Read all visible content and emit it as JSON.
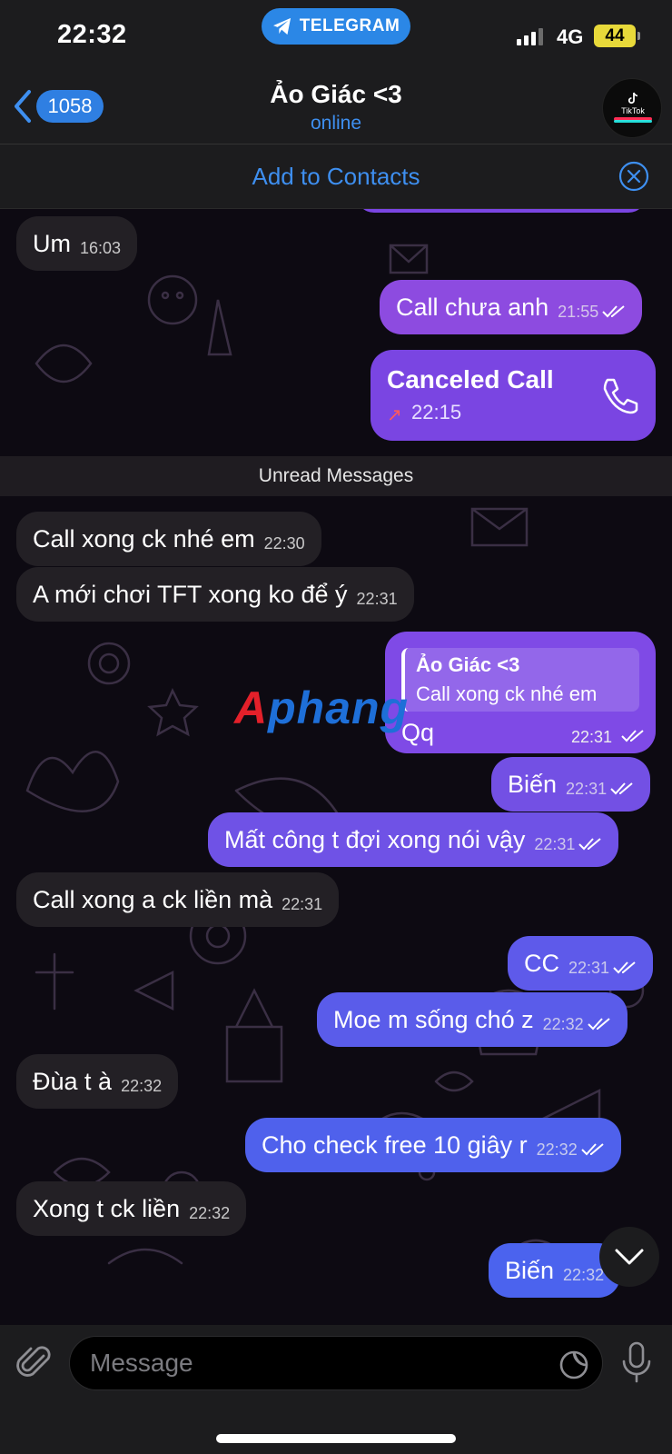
{
  "status_bar": {
    "time": "22:32",
    "app_label": "TELEGRAM",
    "network": "4G",
    "battery": "44"
  },
  "header": {
    "back_count": "1058",
    "title": "Ảo Giác <3",
    "status": "online",
    "avatar_label": "TikTok"
  },
  "banner": {
    "add_contacts": "Add to Contacts"
  },
  "colors": {
    "accent": "#3e8ff0",
    "incoming_bubble": "#232025",
    "outgoing_top": "#8a48e0",
    "outgoing_bottom": "#4a63ec"
  },
  "messages_before": [
    {
      "dir": "in",
      "text": "Um",
      "time": "16:03"
    },
    {
      "dir": "out",
      "text": "Call chưa anh",
      "time": "21:55"
    }
  ],
  "call": {
    "title": "Canceled Call",
    "time": "22:15",
    "icon": "phone-icon"
  },
  "unread_label": "Unread Messages",
  "messages_after": [
    {
      "dir": "in",
      "text": "Call xong ck nhé em",
      "time": "22:30"
    },
    {
      "dir": "in",
      "text": "A mới chơi TFT xong ko để ý",
      "time": "22:31"
    }
  ],
  "reply": {
    "quote_name": "Ảo Giác <3",
    "quote_text": "Call xong ck nhé em",
    "text": "Qq",
    "time": "22:31"
  },
  "watermark": {
    "part_a": "A",
    "part_b": "phang"
  },
  "messages_late": [
    {
      "dir": "out",
      "text": "Biến",
      "time": "22:31"
    },
    {
      "dir": "out",
      "text": "Mất công t đợi xong nói vậy",
      "time": "22:31"
    },
    {
      "dir": "in",
      "text": "Call xong a ck liền mà",
      "time": "22:31"
    },
    {
      "dir": "out",
      "text": "CC",
      "time": "22:31"
    },
    {
      "dir": "out",
      "text": "Moe m sống chó z",
      "time": "22:32"
    },
    {
      "dir": "in",
      "text": "Đùa t à",
      "time": "22:32"
    },
    {
      "dir": "out",
      "text": "Cho check free 10 giây r",
      "time": "22:32"
    },
    {
      "dir": "in",
      "text": "Xong t ck liền",
      "time": "22:32"
    },
    {
      "dir": "out",
      "text": "Biến",
      "time": "22:32"
    }
  ],
  "input": {
    "placeholder": "Message"
  }
}
